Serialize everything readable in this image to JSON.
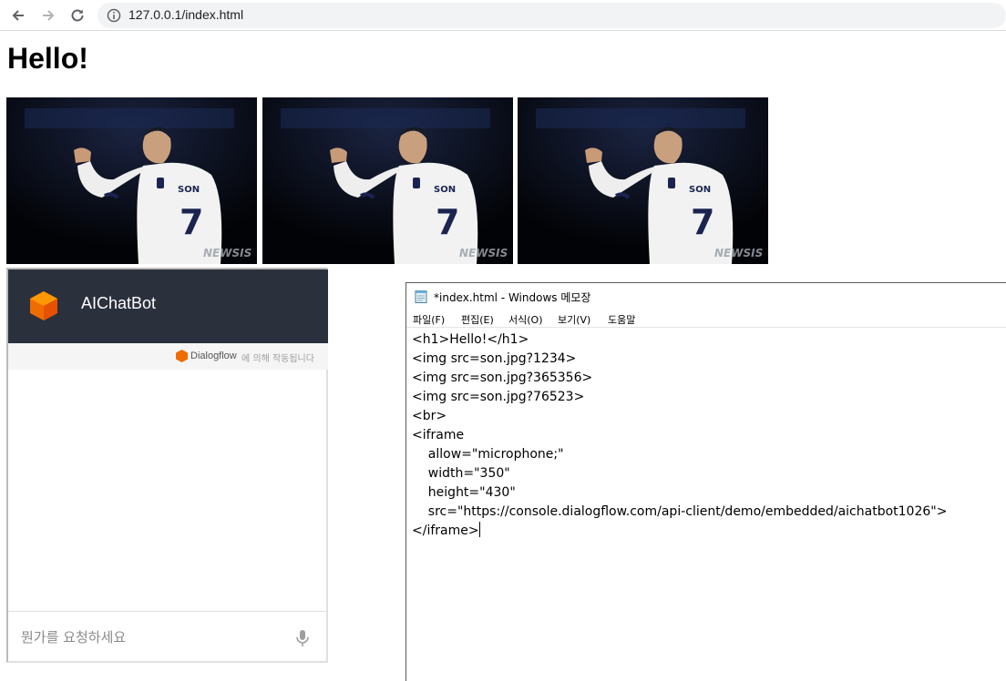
{
  "browser": {
    "url": "127.0.0.1/index.html",
    "icons": {
      "back": "arrow-left-icon",
      "forward": "arrow-right-icon",
      "reload": "reload-icon",
      "info": "info-icon"
    }
  },
  "page": {
    "heading": "Hello!",
    "photos": [
      {
        "jersey_name": "SON",
        "number": "7",
        "watermark": "NEWSIS"
      },
      {
        "jersey_name": "SON",
        "number": "7",
        "watermark": "NEWSIS"
      },
      {
        "jersey_name": "SON",
        "number": "7",
        "watermark": "NEWSIS"
      }
    ]
  },
  "chatbot": {
    "title": "AIChatBot",
    "powered_by_name": "Dialogflow",
    "powered_by_suffix": "에 의해 작동됩니다",
    "input_placeholder": "뭔가를 요청하세요",
    "header_color": "#2b303d",
    "accent_color": "#ef6c00"
  },
  "notepad": {
    "title": "*index.html - Windows 메모장",
    "menu": [
      "파일(F)",
      "편집(E)",
      "서식(O)",
      "보기(V)",
      "도움말"
    ],
    "lines": [
      "<h1>Hello!</h1>",
      "",
      "",
      "<img src=son.jpg?1234>",
      "<img src=son.jpg?365356>",
      "<img src=son.jpg?76523>",
      "<br>",
      "<iframe",
      "    allow=\"microphone;\"",
      "    width=\"350\"",
      "    height=\"430\"",
      "    src=\"https://console.dialogflow.com/api-client/demo/embedded/aichatbot1026\">",
      "</iframe>"
    ]
  }
}
